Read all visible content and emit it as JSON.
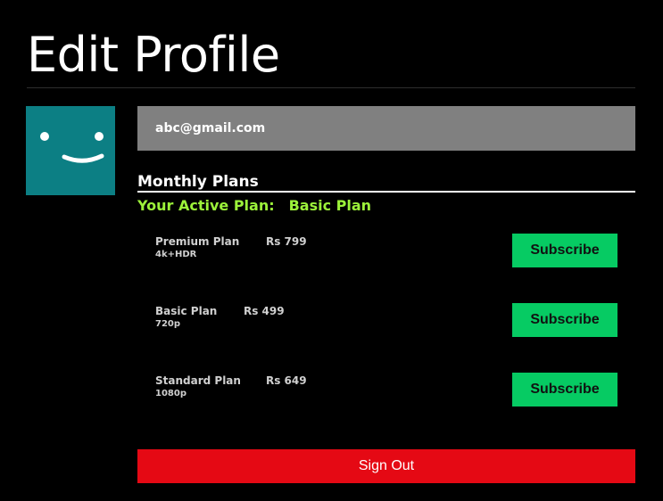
{
  "page": {
    "title": "Edit Profile"
  },
  "profile": {
    "avatar_icon": "smiley-face-icon",
    "avatar_color": "#0c7f84",
    "email": "abc@gmail.com"
  },
  "plans": {
    "heading": "Monthly Plans",
    "active_label": "Your Active Plan:",
    "active_value": "Basic Plan",
    "items": [
      {
        "name": "Premium Plan",
        "price": "Rs 799",
        "quality": "4k+HDR",
        "button": "Subscribe"
      },
      {
        "name": "Basic Plan",
        "price": "Rs 499",
        "quality": "720p",
        "button": "Subscribe"
      },
      {
        "name": "Standard Plan",
        "price": "Rs 649",
        "quality": "1080p",
        "button": "Subscribe"
      }
    ]
  },
  "actions": {
    "sign_out": "Sign Out"
  },
  "colors": {
    "background": "#000000",
    "email_box": "#808080",
    "active_plan": "#9cf23a",
    "subscribe": "#06cb63",
    "sign_out": "#e50914"
  }
}
